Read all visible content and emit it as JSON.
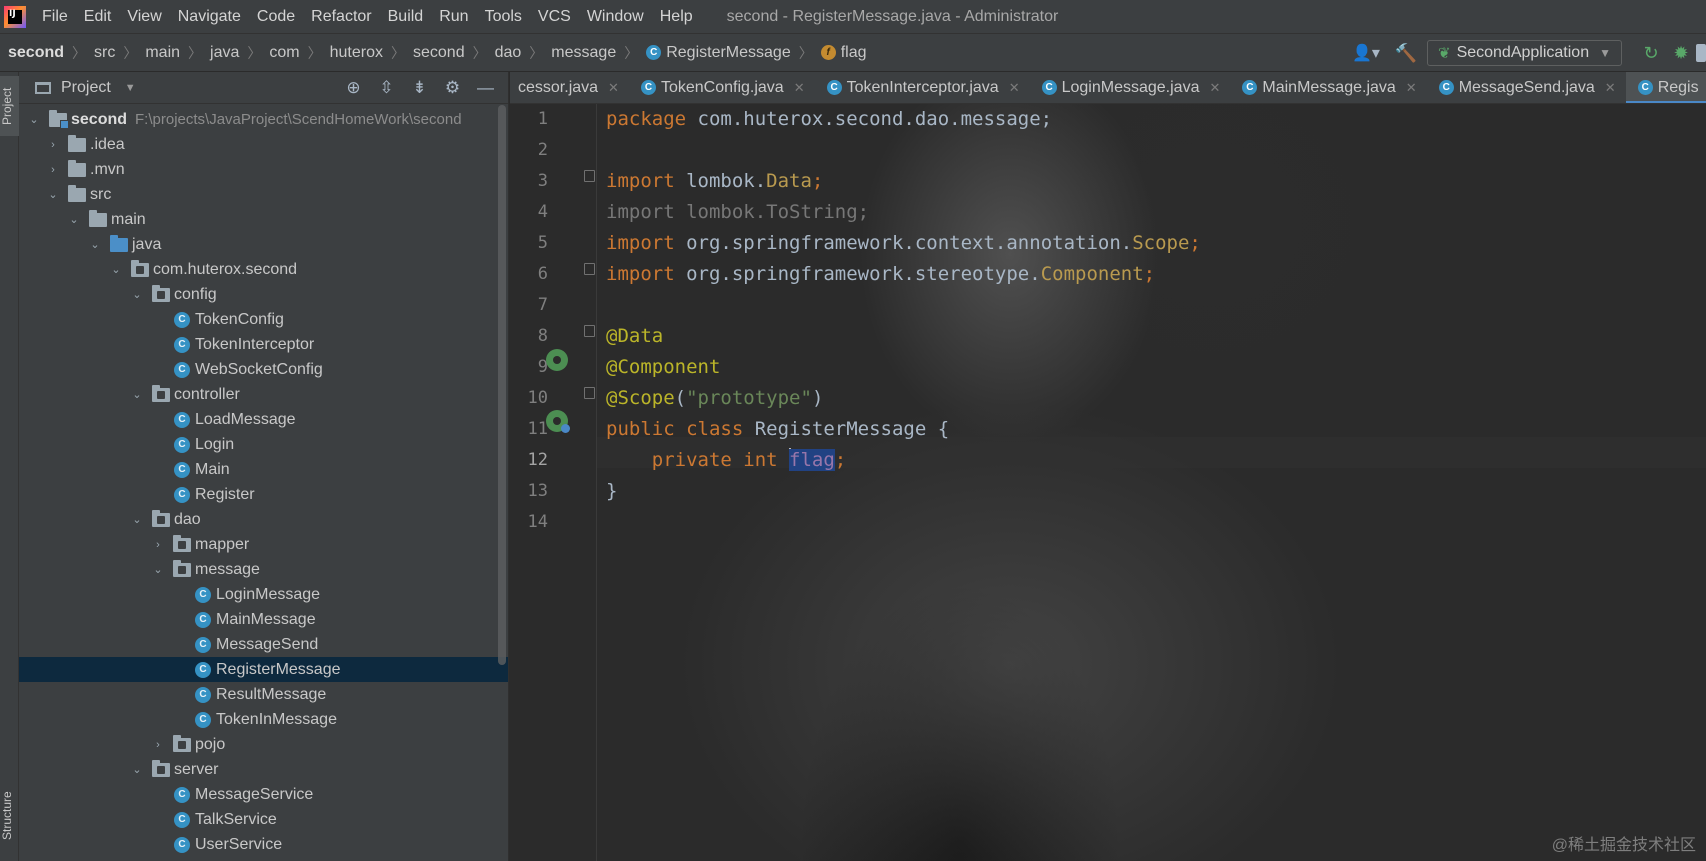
{
  "menubar": {
    "logo_text": "IJ",
    "items": [
      "File",
      "Edit",
      "View",
      "Navigate",
      "Code",
      "Refactor",
      "Build",
      "Run",
      "Tools",
      "VCS",
      "Window",
      "Help"
    ],
    "window_title": "second - RegisterMessage.java - Administrator"
  },
  "breadcrumb": [
    "second",
    "src",
    "main",
    "java",
    "com",
    "huterox",
    "second",
    "dao",
    "message",
    "RegisterMessage",
    "flag"
  ],
  "toolbar": {
    "run_config": "SecondApplication"
  },
  "toolstrip": {
    "project_tab": "Project",
    "structure_tab": "Structure"
  },
  "panel": {
    "title": "Project",
    "root_name": "second",
    "root_path": "F:\\projects\\JavaProject\\ScendHomeWork\\second",
    "tree": [
      {
        "label": ".idea"
      },
      {
        "label": ".mvn"
      },
      {
        "label": "src"
      },
      {
        "label": "main"
      },
      {
        "label": "java"
      },
      {
        "label": "com.huterox.second"
      },
      {
        "label": "config"
      },
      {
        "label": "TokenConfig"
      },
      {
        "label": "TokenInterceptor"
      },
      {
        "label": "WebSocketConfig"
      },
      {
        "label": "controller"
      },
      {
        "label": "LoadMessage"
      },
      {
        "label": "Login"
      },
      {
        "label": "Main"
      },
      {
        "label": "Register"
      },
      {
        "label": "dao"
      },
      {
        "label": "mapper"
      },
      {
        "label": "message"
      },
      {
        "label": "LoginMessage"
      },
      {
        "label": "MainMessage"
      },
      {
        "label": "MessageSend"
      },
      {
        "label": "RegisterMessage"
      },
      {
        "label": "ResultMessage"
      },
      {
        "label": "TokenInMessage"
      },
      {
        "label": "pojo"
      },
      {
        "label": "server"
      },
      {
        "label": "MessageService"
      },
      {
        "label": "TalkService"
      },
      {
        "label": "UserService"
      }
    ]
  },
  "tabs": [
    {
      "label": "cessor.java"
    },
    {
      "label": "TokenConfig.java"
    },
    {
      "label": "TokenInterceptor.java"
    },
    {
      "label": "LoginMessage.java"
    },
    {
      "label": "MainMessage.java"
    },
    {
      "label": "MessageSend.java"
    },
    {
      "label": "Regis"
    }
  ],
  "editor": {
    "line_numbers": [
      "1",
      "2",
      "3",
      "4",
      "5",
      "6",
      "7",
      "8",
      "9",
      "10",
      "11",
      "12",
      "13",
      "14"
    ],
    "current_line": "12",
    "code": {
      "l1_kw": "package",
      "l1_rest": " com.huterox.second.dao.message;",
      "l3_kw": "import",
      "l3_pkg": " lombok.",
      "l3_cls": "Data",
      "l3_end": ";",
      "l4": "import lombok.ToString;",
      "l5_kw": "import",
      "l5_pkg": " org.springframework.context.annotation.",
      "l5_cls": "Scope",
      "l5_end": ";",
      "l6_kw": "import",
      "l6_pkg": " org.springframework.stereotype.",
      "l6_cls": "Component",
      "l6_end": ";",
      "l8": "@Data",
      "l9": "@Component",
      "l10_ann": "@Scope",
      "l10_open": "(",
      "l10_str": "\"prototype\"",
      "l10_close": ")",
      "l11_kw": "public class",
      "l11_name": " RegisterMessage {",
      "l12_kw": "    private int ",
      "l12_field": "flag",
      "l12_end": ";",
      "l13": "}"
    }
  },
  "watermark": "@稀土掘金技术社区"
}
